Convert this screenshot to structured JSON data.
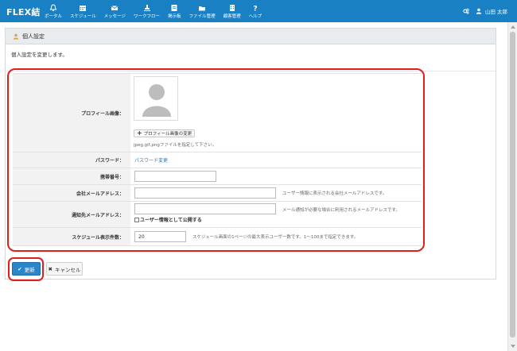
{
  "brand": "FLEX結",
  "nav": [
    {
      "label": "ポータル",
      "icon": "bell-icon"
    },
    {
      "label": "スケジュール",
      "icon": "calendar-icon"
    },
    {
      "label": "メッセージ",
      "icon": "envelope-icon"
    },
    {
      "label": "ワークフロー",
      "icon": "stamp-icon"
    },
    {
      "label": "掲示板",
      "icon": "board-icon"
    },
    {
      "label": "ファイル管理",
      "icon": "folder-icon"
    },
    {
      "label": "顧客管理",
      "icon": "building-icon"
    },
    {
      "label": "ヘルプ",
      "icon": "question-icon"
    }
  ],
  "user": {
    "name": "山田 太郎",
    "settings_icon": "gears-icon",
    "user_icon": "user-icon"
  },
  "panel": {
    "title": "個人設定",
    "description": "個人設定を変更します。"
  },
  "form": {
    "profile_image": {
      "label": "プロフィール画像：",
      "change_button": "プロフィール画像の変更",
      "hint": "jpeg,gif,pngファイルを指定して下さい。"
    },
    "password": {
      "label": "パスワード：",
      "link": "パスワード変更"
    },
    "mobile": {
      "label": "携帯番号：",
      "value": ""
    },
    "company_email": {
      "label": "会社メールアドレス：",
      "value": "",
      "help": "ユーザー情報に表示される会社メールアドレスです。"
    },
    "notify_email": {
      "label": "通知先メールアドレス：",
      "value": "",
      "help": "メール通知が必要な場合に利用されるメールアドレスです。",
      "checkbox_label": "ユーザー情報として公開する",
      "checked": false
    },
    "schedule_count": {
      "label": "スケジュール表示件数：",
      "value": "20",
      "help": "スケジュール画面の1ページの最大表示ユーザー数です。1〜100まで指定できます。"
    }
  },
  "buttons": {
    "update": "更新",
    "cancel": "キャンセル"
  },
  "colors": {
    "header": "#1a80c4",
    "primary": "#2c85c9",
    "highlight": "#e01e1e",
    "link": "#2a7ab8"
  }
}
